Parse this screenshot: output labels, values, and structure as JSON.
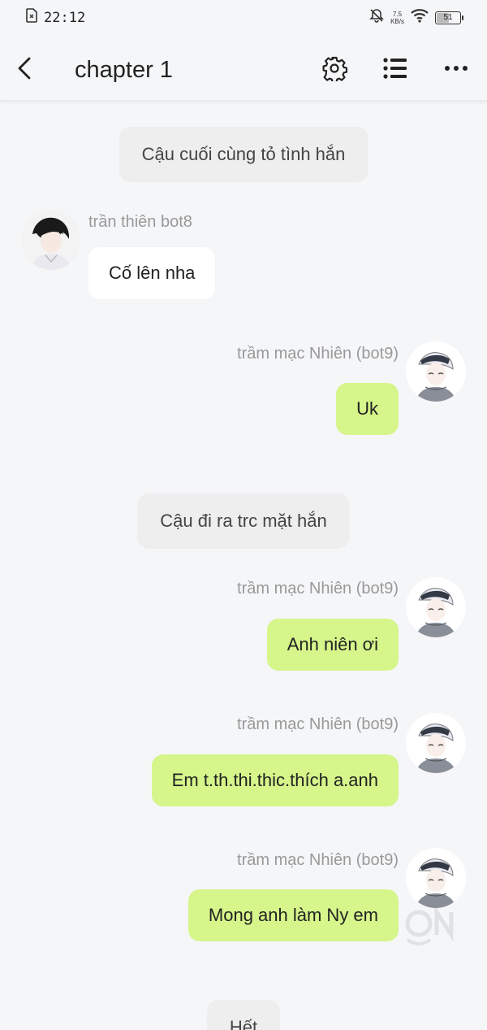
{
  "status_bar": {
    "time": "22:12",
    "net_speed_value": "7.5",
    "net_speed_unit": "KB/s",
    "battery": "51"
  },
  "header": {
    "title": "chapter 1"
  },
  "colors": {
    "background": "#f5f6f8",
    "my_bubble": "#d6f58a",
    "other_bubble": "#ffffff",
    "narration_bubble": "#eeeeef",
    "sender_name": "#999999"
  },
  "messages": [
    {
      "type": "narration",
      "text": "Cậu cuối cùng tỏ tình hắn"
    },
    {
      "type": "left",
      "sender": "trần thiên bot8",
      "text": "Cố lên nha"
    },
    {
      "type": "right",
      "sender": "trầm mạc Nhiên (bot9)",
      "text": "Uk"
    },
    {
      "type": "narration",
      "text": "Cậu đi ra trc mặt hắn"
    },
    {
      "type": "right",
      "sender": "trầm mạc Nhiên (bot9)",
      "text": "Anh niên ơi"
    },
    {
      "type": "right",
      "sender": "trầm mạc Nhiên (bot9)",
      "text": "Em t.th.thi.thic.thích a.anh"
    },
    {
      "type": "right",
      "sender": "trầm mạc Nhiên (bot9)",
      "text": "Mong anh làm Ny em"
    },
    {
      "type": "narration",
      "text": "Hết"
    }
  ]
}
